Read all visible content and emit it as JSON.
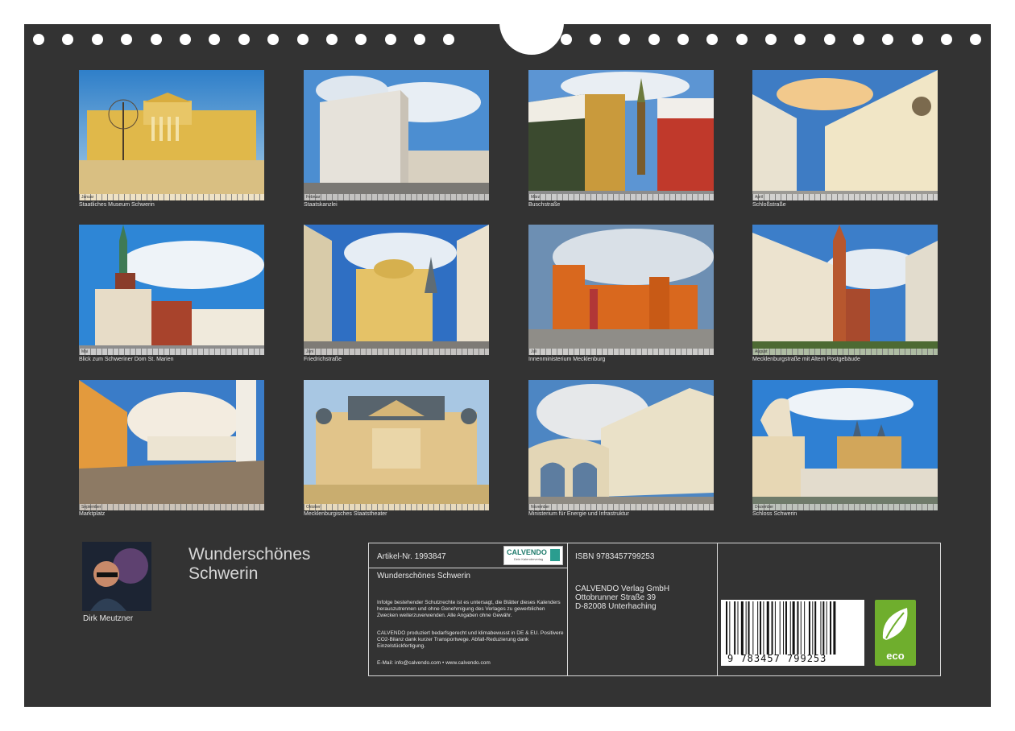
{
  "captions": [
    "Staatliches Museum Schwerin",
    "Staatskanzlei",
    "Buschstraße",
    "Schloßstraße",
    "Blick zum Schweriner Dom St. Marien",
    "Friedrichstraße",
    "Innenministerium Mecklenburg",
    "Mecklenburgstraße mit Altem Postgebäude",
    "Marktplatz",
    "Mecklenburgisches Staatstheater",
    "Ministerium für Energie und Infrastruktur",
    "Schloss Schwerin"
  ],
  "author": "Dirk Meutzner",
  "title_line1": "Wunderschönes",
  "title_line2": "Schwerin",
  "article_no": "Artikel-Nr. 1993847",
  "article_title": "Wunderschönes Schwerin",
  "legal_text": "Infolge bestehender Schutzrechte ist es untersagt, die Blätter dieses Kalenders herauszutrennen und ohne Genehmigung des Verlages zu gewerblichen Zwecken weiterzuverwenden. Alle Angaben ohne Gewähr.",
  "eco_text": "CALVENDO produziert bedarfsgerecht und klimabewusst in DE & EU. Positivere CO2-Bilanz dank kurzer Transportwege. Abfall-Reduzierung dank Einzelstückfertigung.",
  "contact": "E-Mail: info@calvendo.com • www.calvendo.com",
  "isbn": "ISBN 9783457799253",
  "publisher": "CALVENDO Verlag GmbH",
  "street": "Ottobrunner Straße 39",
  "city": "D-82008 Unterhaching",
  "logo_text": "CALVENDO",
  "logo_sub": "Dein Kalenderverlag",
  "barcode_digits": "9 783457 799253",
  "eco_label": "eco"
}
